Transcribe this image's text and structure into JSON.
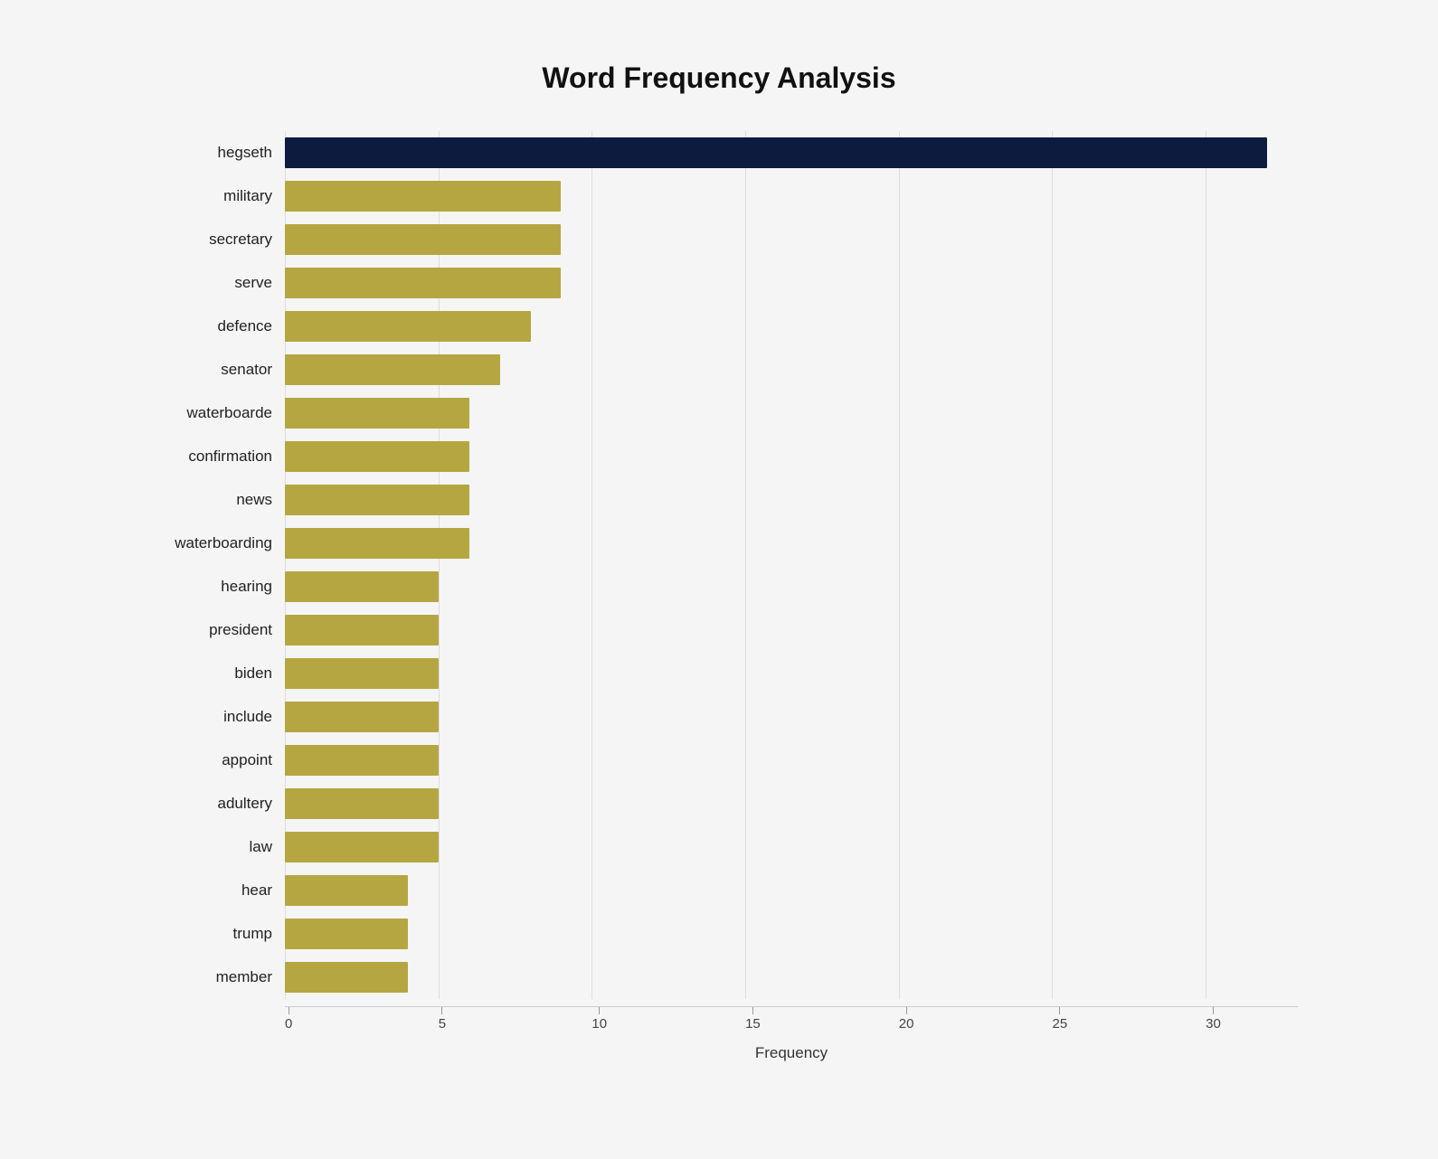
{
  "title": "Word Frequency Analysis",
  "x_axis_label": "Frequency",
  "x_ticks": [
    0,
    5,
    10,
    15,
    20,
    25,
    30
  ],
  "max_value": 33,
  "bars": [
    {
      "label": "hegseth",
      "value": 32,
      "type": "dark"
    },
    {
      "label": "military",
      "value": 9,
      "type": "gold"
    },
    {
      "label": "secretary",
      "value": 9,
      "type": "gold"
    },
    {
      "label": "serve",
      "value": 9,
      "type": "gold"
    },
    {
      "label": "defence",
      "value": 8,
      "type": "gold"
    },
    {
      "label": "senator",
      "value": 7,
      "type": "gold"
    },
    {
      "label": "waterboarde",
      "value": 6,
      "type": "gold"
    },
    {
      "label": "confirmation",
      "value": 6,
      "type": "gold"
    },
    {
      "label": "news",
      "value": 6,
      "type": "gold"
    },
    {
      "label": "waterboarding",
      "value": 6,
      "type": "gold"
    },
    {
      "label": "hearing",
      "value": 5,
      "type": "gold"
    },
    {
      "label": "president",
      "value": 5,
      "type": "gold"
    },
    {
      "label": "biden",
      "value": 5,
      "type": "gold"
    },
    {
      "label": "include",
      "value": 5,
      "type": "gold"
    },
    {
      "label": "appoint",
      "value": 5,
      "type": "gold"
    },
    {
      "label": "adultery",
      "value": 5,
      "type": "gold"
    },
    {
      "label": "law",
      "value": 5,
      "type": "gold"
    },
    {
      "label": "hear",
      "value": 4,
      "type": "gold"
    },
    {
      "label": "trump",
      "value": 4,
      "type": "gold"
    },
    {
      "label": "member",
      "value": 4,
      "type": "gold"
    }
  ]
}
